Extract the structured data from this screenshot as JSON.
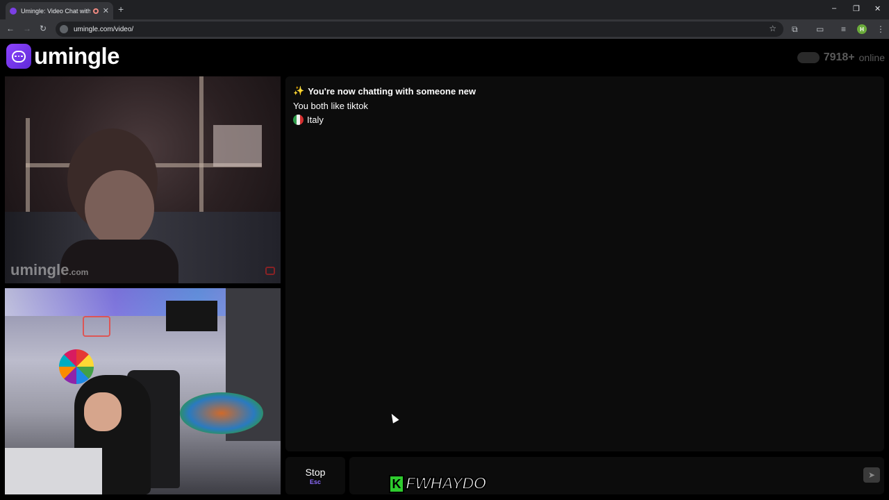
{
  "browser": {
    "tab_title": "Umingle: Video Chat with S",
    "tab_close": "✕",
    "new_tab": "+",
    "url": "umingle.com/video/",
    "profile_initial": "H",
    "window_controls": [
      "–",
      "❐",
      "✕"
    ]
  },
  "header": {
    "logo_text": "umingle",
    "online_count": "7918+",
    "online_label": "online"
  },
  "remote_video": {
    "watermark": "umingle",
    "watermark_suffix": ".com"
  },
  "chat": {
    "intro_icon": "✨",
    "intro": "You're now chatting with someone new",
    "interest": "You both like tiktok",
    "country": "Italy"
  },
  "controls": {
    "stop_label": "Stop",
    "stop_shortcut": "Esc",
    "message_placeholder": "",
    "send_icon": "send-icon"
  },
  "overlay": {
    "badge": "K",
    "text": "FWHAYDO"
  },
  "colors": {
    "brand": "#7b3fe4",
    "background": "#000000",
    "panel": "#0c0c0c"
  }
}
